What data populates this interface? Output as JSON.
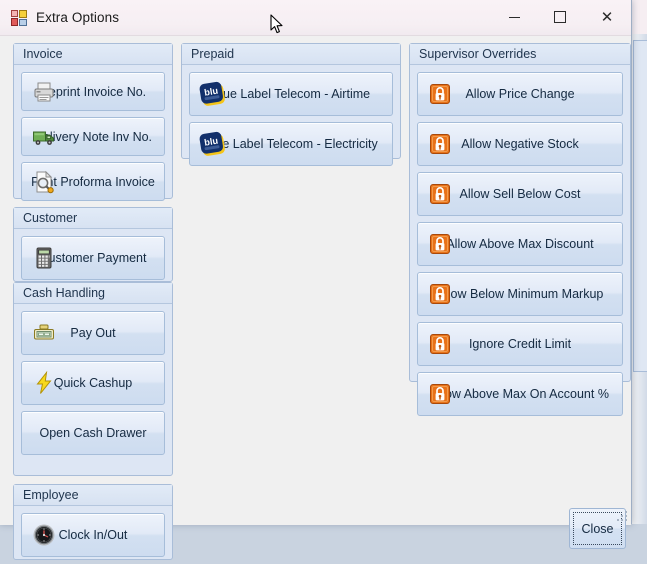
{
  "window": {
    "title": "Extra Options",
    "icon": "app-grid-icon",
    "controls": {
      "minimize": "—",
      "maximize": "□",
      "close": "✕"
    }
  },
  "colors": {
    "titlebar": "#f6eff3",
    "form_background": "#f0f0f0",
    "group_background": "#dde6f4",
    "group_border": "#a9bdd8",
    "button_face_top": "#eef3fb",
    "button_face_bottom": "#cddcf0",
    "text": "#152a41",
    "lock_icon_orange": "#e8721a",
    "blu_navy": "#12306b",
    "blu_yellow": "#f5c518",
    "truck_green": "#4a8f3c",
    "bolt_yellow": "#f5d213"
  },
  "groups": [
    {
      "name": "invoice",
      "title": "Invoice",
      "buttons": [
        {
          "label": "Reprint Invoice No.",
          "icon": "printer-icon"
        },
        {
          "label": "Delivery Note Inv No.",
          "icon": "delivery-truck-icon"
        },
        {
          "label": "Print Proforma Invoice",
          "icon": "print-preview-icon"
        }
      ]
    },
    {
      "name": "customer",
      "title": "Customer",
      "buttons": [
        {
          "label": "Customer Payment",
          "icon": "calculator-icon"
        }
      ]
    },
    {
      "name": "cash-handling",
      "title": "Cash Handling",
      "buttons": [
        {
          "label": "Pay Out",
          "icon": "cash-register-icon"
        },
        {
          "label": "Quick Cashup",
          "icon": "lightning-bolt-icon"
        },
        {
          "label": "Open Cash Drawer",
          "icon": "none"
        }
      ]
    },
    {
      "name": "employee",
      "title": "Employee",
      "buttons": [
        {
          "label": "Clock In/Out",
          "icon": "clock-icon"
        }
      ]
    },
    {
      "name": "prepaid",
      "title": "Prepaid",
      "buttons": [
        {
          "label": "Blue Label Telecom - Airtime",
          "icon": "blu-logo-icon"
        },
        {
          "label": "Blue Label Telecom - Electricity",
          "icon": "blu-logo-icon"
        }
      ]
    },
    {
      "name": "supervisor-overrides",
      "title": "Supervisor Overrides",
      "buttons": [
        {
          "label": "Allow Price Change",
          "icon": "padlock-icon"
        },
        {
          "label": "Allow Negative Stock",
          "icon": "padlock-icon"
        },
        {
          "label": "Allow Sell Below Cost",
          "icon": "padlock-icon"
        },
        {
          "label": "Allow Above Max Discount",
          "icon": "padlock-icon"
        },
        {
          "label": "Allow Below Minimum Markup",
          "icon": "padlock-icon"
        },
        {
          "label": "Ignore Credit Limit",
          "icon": "padlock-icon"
        },
        {
          "label": "Allow Above Max On Account %",
          "icon": "padlock-icon"
        }
      ]
    }
  ],
  "footer": {
    "close_label": "Close"
  },
  "blu_logo": {
    "wordmark": "blu",
    "tagline": "APPROVED"
  }
}
